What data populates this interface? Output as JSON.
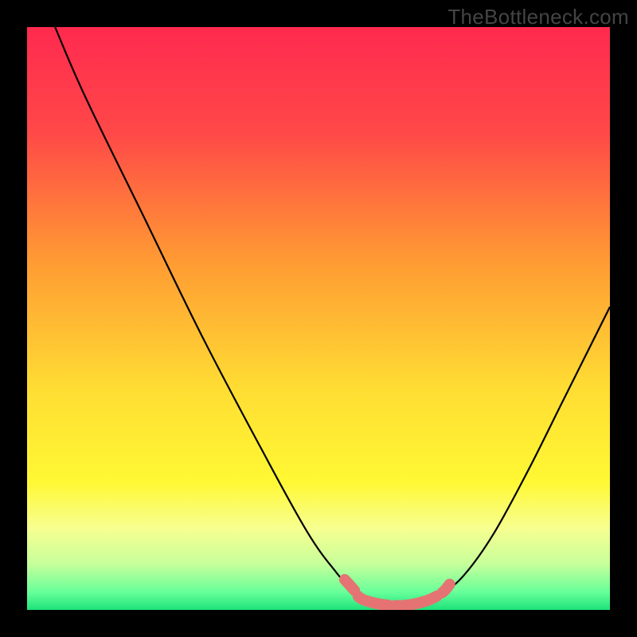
{
  "watermark": "TheBottleneck.com",
  "chart_data": {
    "type": "line",
    "title": "",
    "xlabel": "",
    "ylabel": "",
    "xlim": [
      0,
      100
    ],
    "ylim": [
      0,
      100
    ],
    "gradient_stops": [
      {
        "offset": 0,
        "color": "#ff2a4f"
      },
      {
        "offset": 18,
        "color": "#ff4848"
      },
      {
        "offset": 40,
        "color": "#ff9a33"
      },
      {
        "offset": 62,
        "color": "#ffdd33"
      },
      {
        "offset": 78,
        "color": "#fff833"
      },
      {
        "offset": 86,
        "color": "#f7ff90"
      },
      {
        "offset": 92,
        "color": "#c8ff9a"
      },
      {
        "offset": 97,
        "color": "#66ff99"
      },
      {
        "offset": 100,
        "color": "#1de27b"
      }
    ],
    "series": [
      {
        "name": "bottleneck-curve",
        "stroke": "#000000",
        "stroke_width": 2.2,
        "points": [
          {
            "x": 4.8,
            "y": 100
          },
          {
            "x": 10,
            "y": 88
          },
          {
            "x": 20,
            "y": 67.5
          },
          {
            "x": 30,
            "y": 47
          },
          {
            "x": 40,
            "y": 28
          },
          {
            "x": 48,
            "y": 13.5
          },
          {
            "x": 53,
            "y": 6.5
          },
          {
            "x": 56,
            "y": 3.3
          },
          {
            "x": 59,
            "y": 1.4
          },
          {
            "x": 62,
            "y": 0.7
          },
          {
            "x": 65,
            "y": 0.7
          },
          {
            "x": 68,
            "y": 1.2
          },
          {
            "x": 71,
            "y": 2.6
          },
          {
            "x": 75,
            "y": 6
          },
          {
            "x": 80,
            "y": 13
          },
          {
            "x": 86,
            "y": 24
          },
          {
            "x": 92,
            "y": 36
          },
          {
            "x": 100,
            "y": 52
          }
        ]
      },
      {
        "name": "highlight-band",
        "stroke": "#e57373",
        "stroke_width": 14,
        "linecap": "round",
        "points": [
          {
            "x": 54.5,
            "y": 5.2
          },
          {
            "x": 56.3,
            "y": 3.2
          },
          {
            "x": 57.2,
            "y": 2
          },
          {
            "x": 59.5,
            "y": 1.2
          },
          {
            "x": 62,
            "y": 0.8
          },
          {
            "x": 65,
            "y": 0.8
          },
          {
            "x": 68,
            "y": 1.4
          },
          {
            "x": 70,
            "y": 2.2
          },
          {
            "x": 71.5,
            "y": 3.2
          },
          {
            "x": 72.5,
            "y": 4.4
          }
        ]
      }
    ]
  }
}
